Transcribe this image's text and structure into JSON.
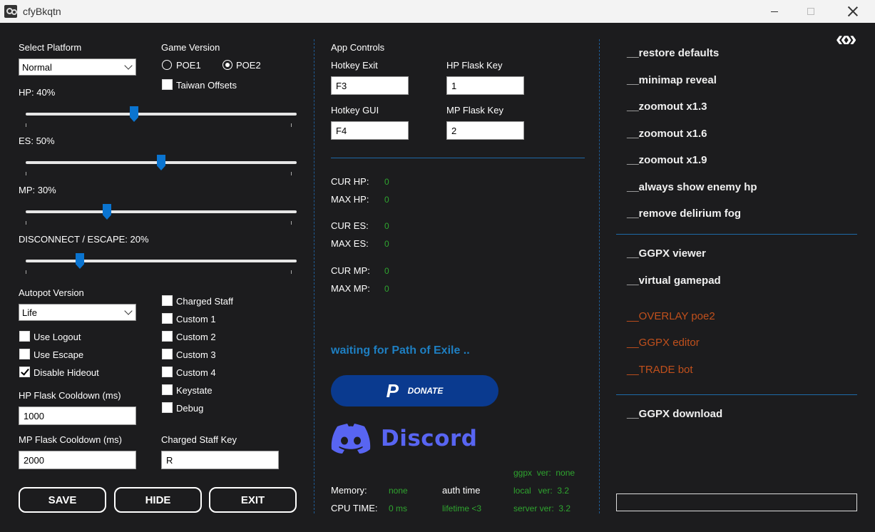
{
  "window": {
    "title": "cfyBkqtn"
  },
  "platform": {
    "label": "Select Platform",
    "value": "Normal"
  },
  "game_version": {
    "label": "Game Version",
    "poe1": "POE1",
    "poe2": "POE2",
    "selected": "POE2",
    "taiwan_offsets": "Taiwan Offsets",
    "taiwan_checked": false
  },
  "sliders": [
    {
      "label": "HP: 40%",
      "value": 40
    },
    {
      "label": "ES: 50%",
      "value": 50
    },
    {
      "label": "MP: 30%",
      "value": 30
    },
    {
      "label": "DISCONNECT / ESCAPE: 20%",
      "value": 20
    }
  ],
  "autopot": {
    "label": "Autopot Version",
    "value": "Life"
  },
  "left_checks": [
    {
      "label": "Use Logout",
      "checked": false
    },
    {
      "label": "Use Escape",
      "checked": false
    },
    {
      "label": "Disable Hideout",
      "checked": true
    }
  ],
  "right_checks": [
    {
      "label": "Charged Staff",
      "checked": false
    },
    {
      "label": "Custom 1",
      "checked": false
    },
    {
      "label": "Custom 2",
      "checked": false
    },
    {
      "label": "Custom 3",
      "checked": false
    },
    {
      "label": "Custom 4",
      "checked": false
    },
    {
      "label": "Keystate",
      "checked": false
    },
    {
      "label": "Debug",
      "checked": false
    }
  ],
  "hp_cooldown": {
    "label": "HP Flask Cooldown (ms)",
    "value": "1000"
  },
  "mp_cooldown": {
    "label": "MP Flask Cooldown (ms)",
    "value": "2000"
  },
  "staff_key": {
    "label": "Charged Staff Key",
    "value": "R"
  },
  "buttons": {
    "save": "SAVE",
    "hide": "HIDE",
    "exit": "EXIT"
  },
  "app_controls": {
    "label": "App Controls",
    "hotkey_exit_label": "Hotkey Exit",
    "hotkey_exit": "F3",
    "hp_flask_label": "HP Flask Key",
    "hp_flask": "1",
    "hotkey_gui_label": "Hotkey GUI",
    "hotkey_gui": "F4",
    "mp_flask_label": "MP Flask Key",
    "mp_flask": "2"
  },
  "stats": [
    {
      "label": "CUR HP:",
      "value": "0"
    },
    {
      "label": "MAX HP:",
      "value": "0"
    },
    {
      "label": "CUR ES:",
      "value": "0"
    },
    {
      "label": "MAX ES:",
      "value": "0"
    },
    {
      "label": "CUR MP:",
      "value": "0"
    },
    {
      "label": "MAX MP:",
      "value": "0"
    }
  ],
  "status": {
    "waiting": "waiting for Path of Exile .."
  },
  "donate": {
    "label": "DONATE"
  },
  "discord": {
    "label": "Discord"
  },
  "footer": {
    "memory_label": "Memory:",
    "memory_value": "none",
    "cpu_label": "CPU TIME:",
    "cpu_value": "0 ms",
    "auth_label": "auth time",
    "lifetime": "lifetime <3",
    "ggpx_ver": "ggpx  ver:  none",
    "local_ver": "local   ver:  3.2",
    "server_ver": "server ver:  3.2"
  },
  "nav": {
    "arrows": "«»"
  },
  "menu": {
    "group1": [
      "__restore defaults",
      "__minimap reveal",
      "__zoomout x1.3",
      "__zoomout x1.6",
      "__zoomout x1.9",
      "__always show enemy hp",
      "__remove delirium fog"
    ],
    "group2": [
      "__GGPX viewer",
      "__virtual gamepad"
    ],
    "group3": [
      "__OVERLAY poe2",
      "__GGPX editor",
      "__TRADE bot"
    ],
    "group4": [
      "__GGPX download"
    ]
  },
  "colors": {
    "accent_blue": "#0a74d0",
    "status_green": "#2fa52f",
    "orange": "#c1501c",
    "discord": "#5865f2"
  }
}
